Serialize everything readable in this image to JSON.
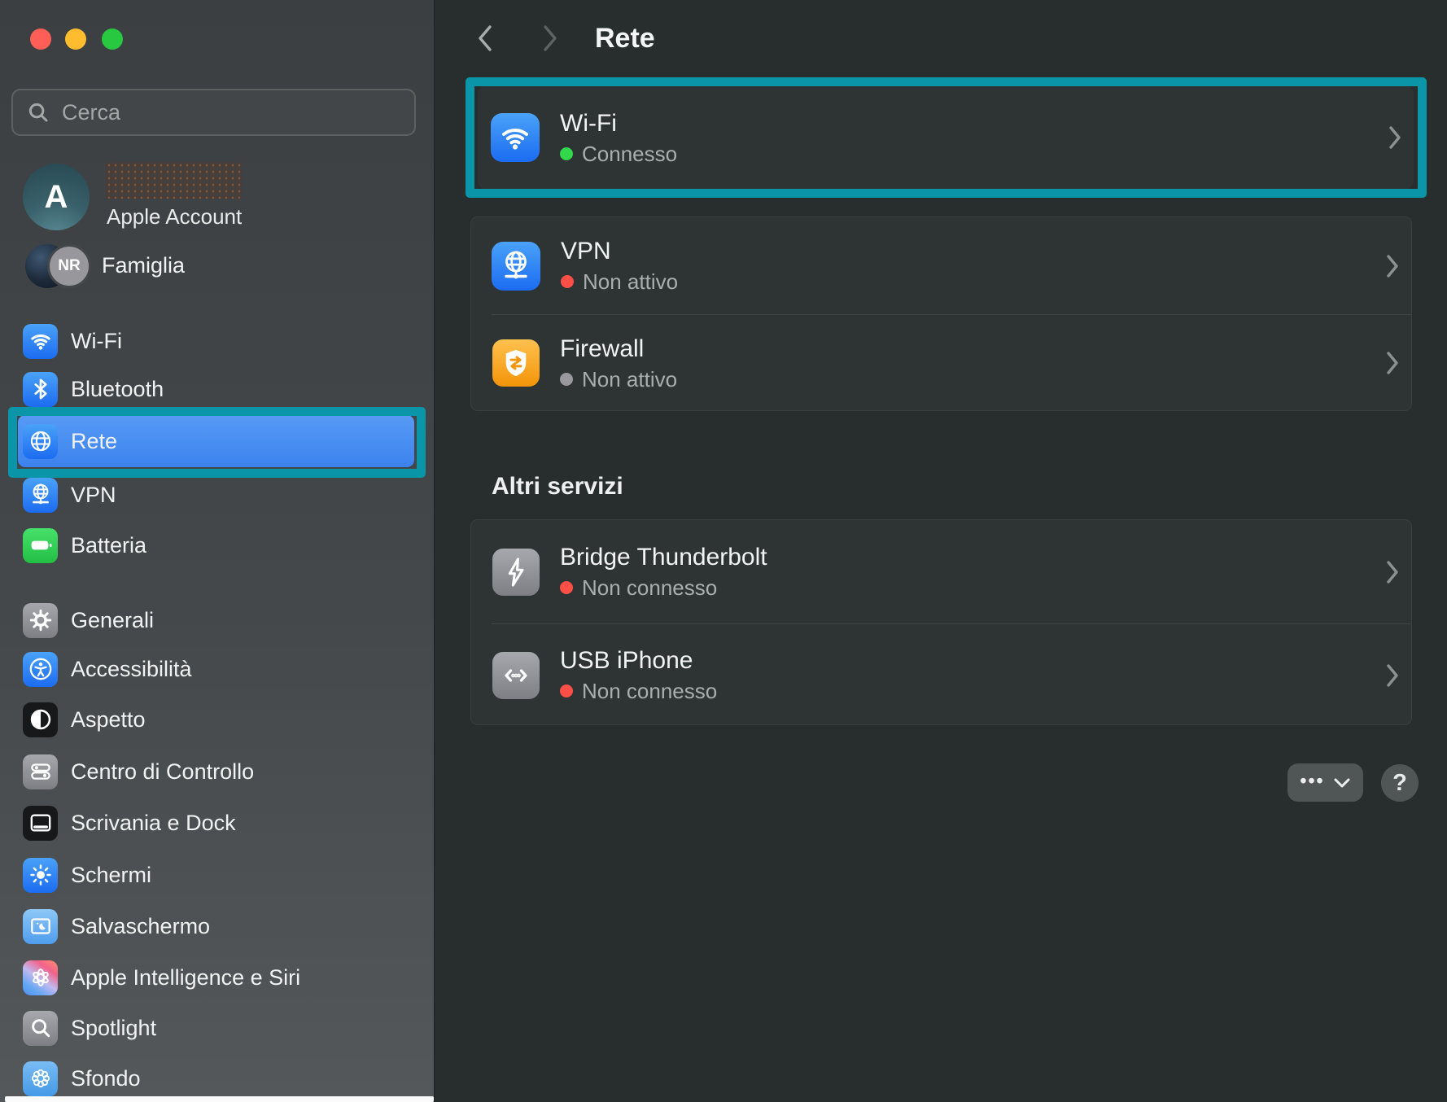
{
  "colors": {
    "annotation_teal": "#0b95a8",
    "status_green": "#32d74b",
    "status_red": "#ff4f47",
    "status_gray": "#98989d",
    "selection_blue": "#4a93f4"
  },
  "sidebar": {
    "search": {
      "placeholder": "Cerca"
    },
    "account": {
      "initial": "A",
      "label": "Apple Account"
    },
    "family": {
      "label": "Famiglia",
      "badge": "NR"
    },
    "nav": [
      {
        "label": "Wi-Fi",
        "icon": "wifi-icon",
        "selected": false
      },
      {
        "label": "Bluetooth",
        "icon": "bluetooth-icon",
        "selected": false
      },
      {
        "label": "Rete",
        "icon": "globe-icon",
        "selected": true
      },
      {
        "label": "VPN",
        "icon": "vpn-globe-icon",
        "selected": false
      },
      {
        "label": "Batteria",
        "icon": "battery-icon",
        "selected": false
      },
      {
        "label": "Generali",
        "icon": "gear-icon",
        "selected": false
      },
      {
        "label": "Accessibilità",
        "icon": "accessibility-icon",
        "selected": false
      },
      {
        "label": "Aspetto",
        "icon": "contrast-icon",
        "selected": false
      },
      {
        "label": "Centro di Controllo",
        "icon": "toggles-icon",
        "selected": false
      },
      {
        "label": "Scrivania e Dock",
        "icon": "desktop-dock-icon",
        "selected": false
      },
      {
        "label": "Schermi",
        "icon": "sun-icon",
        "selected": false
      },
      {
        "label": "Salvaschermo",
        "icon": "screensaver-icon",
        "selected": false
      },
      {
        "label": "Apple Intelligence e Siri",
        "icon": "siri-icon",
        "selected": false
      },
      {
        "label": "Spotlight",
        "icon": "magnifier-icon",
        "selected": false
      },
      {
        "label": "Sfondo",
        "icon": "flower-icon",
        "selected": false
      }
    ]
  },
  "header": {
    "title": "Rete"
  },
  "main": {
    "wifi_row": {
      "title": "Wi-Fi",
      "status": "Connesso",
      "status_color": "#32d74b"
    },
    "vpn_row": {
      "title": "VPN",
      "status": "Non attivo",
      "status_color": "#ff4f47"
    },
    "firewall_row": {
      "title": "Firewall",
      "status": "Non attivo",
      "status_color": "#98989d"
    },
    "section_title": "Altri servizi",
    "bridge_row": {
      "title": "Bridge Thunderbolt",
      "status": "Non connesso",
      "status_color": "#ff4f47"
    },
    "usb_row": {
      "title": "USB iPhone",
      "status": "Non connesso",
      "status_color": "#ff4f47"
    },
    "footer": {
      "more_label": "•••",
      "help_label": "?"
    }
  }
}
